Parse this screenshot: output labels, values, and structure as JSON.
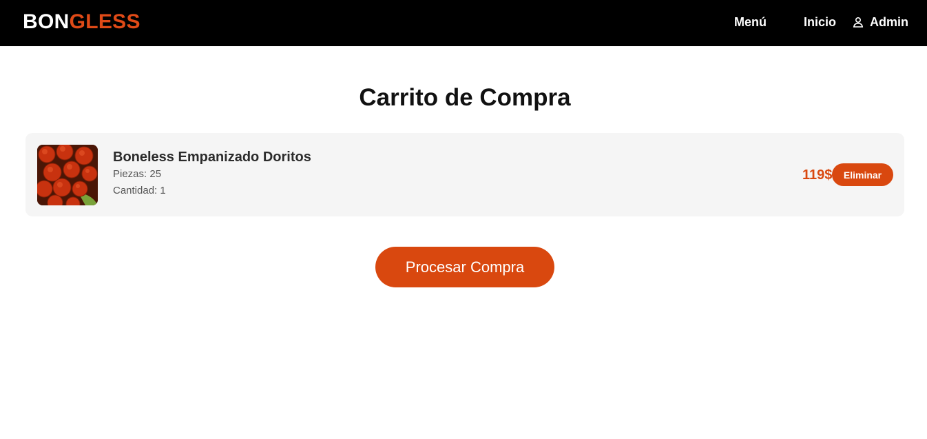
{
  "brand": {
    "part1": "BON",
    "part2": "GLESS"
  },
  "nav": {
    "menu": "Menú",
    "inicio": "Inicio",
    "admin": "Admin",
    "admin_icon": "user-icon"
  },
  "page": {
    "title": "Carrito de Compra"
  },
  "cart": {
    "items": [
      {
        "name": "Boneless Empanizado Doritos",
        "pieces": "Piezas: 25",
        "quantity": "Cantidad: 1",
        "price": "119$",
        "remove_label": "Eliminar"
      }
    ]
  },
  "checkout": {
    "label": "Procesar Compra"
  },
  "colors": {
    "accent": "#d9480f",
    "header_bg": "#000000",
    "item_bg": "#f5f5f5"
  }
}
